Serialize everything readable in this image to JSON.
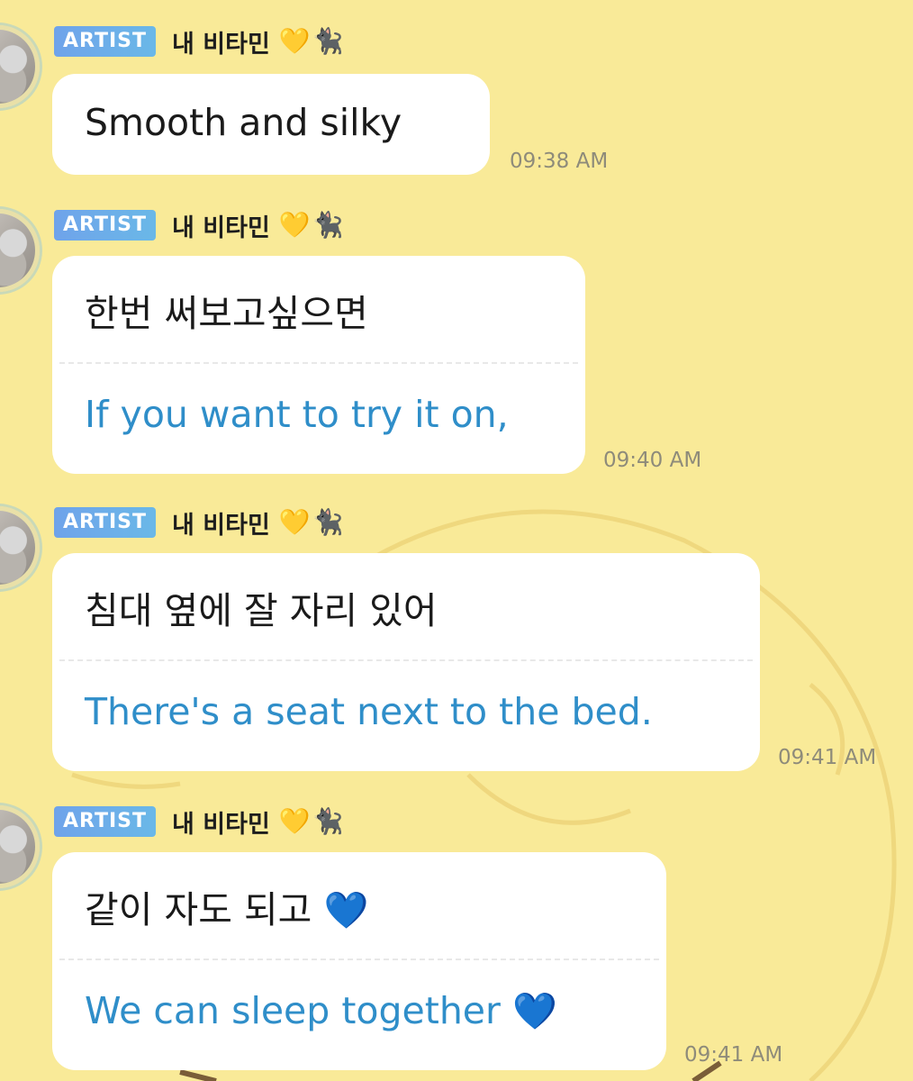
{
  "messages": [
    {
      "badge": "ARTIST",
      "sender": "내 비타민",
      "sender_emoji_heart": "💛",
      "sender_emoji_cat": "🐈‍⬛",
      "text": "Smooth and silky",
      "time": "09:38 AM"
    },
    {
      "badge": "ARTIST",
      "sender": "내 비타민",
      "sender_emoji_heart": "💛",
      "sender_emoji_cat": "🐈‍⬛",
      "original": "한번 써보고싶으면",
      "translation": "If you want to try it on,",
      "time": "09:40 AM"
    },
    {
      "badge": "ARTIST",
      "sender": "내 비타민",
      "sender_emoji_heart": "💛",
      "sender_emoji_cat": "🐈‍⬛",
      "original": "침대 옆에 잘 자리 있어",
      "translation": "There's a seat next to the bed.",
      "time": "09:41 AM"
    },
    {
      "badge": "ARTIST",
      "sender": "내 비타민",
      "sender_emoji_heart": "💛",
      "sender_emoji_cat": "🐈‍⬛",
      "original": "같이 자도 되고",
      "original_emoji": "💙",
      "translation": "We can sleep together",
      "translation_emoji": "💙",
      "time": "09:41 AM"
    }
  ],
  "colors": {
    "background": "#f9ea98",
    "badge": "#6fa3ea",
    "translation_text": "#2f8ec9",
    "bubble": "#ffffff"
  }
}
